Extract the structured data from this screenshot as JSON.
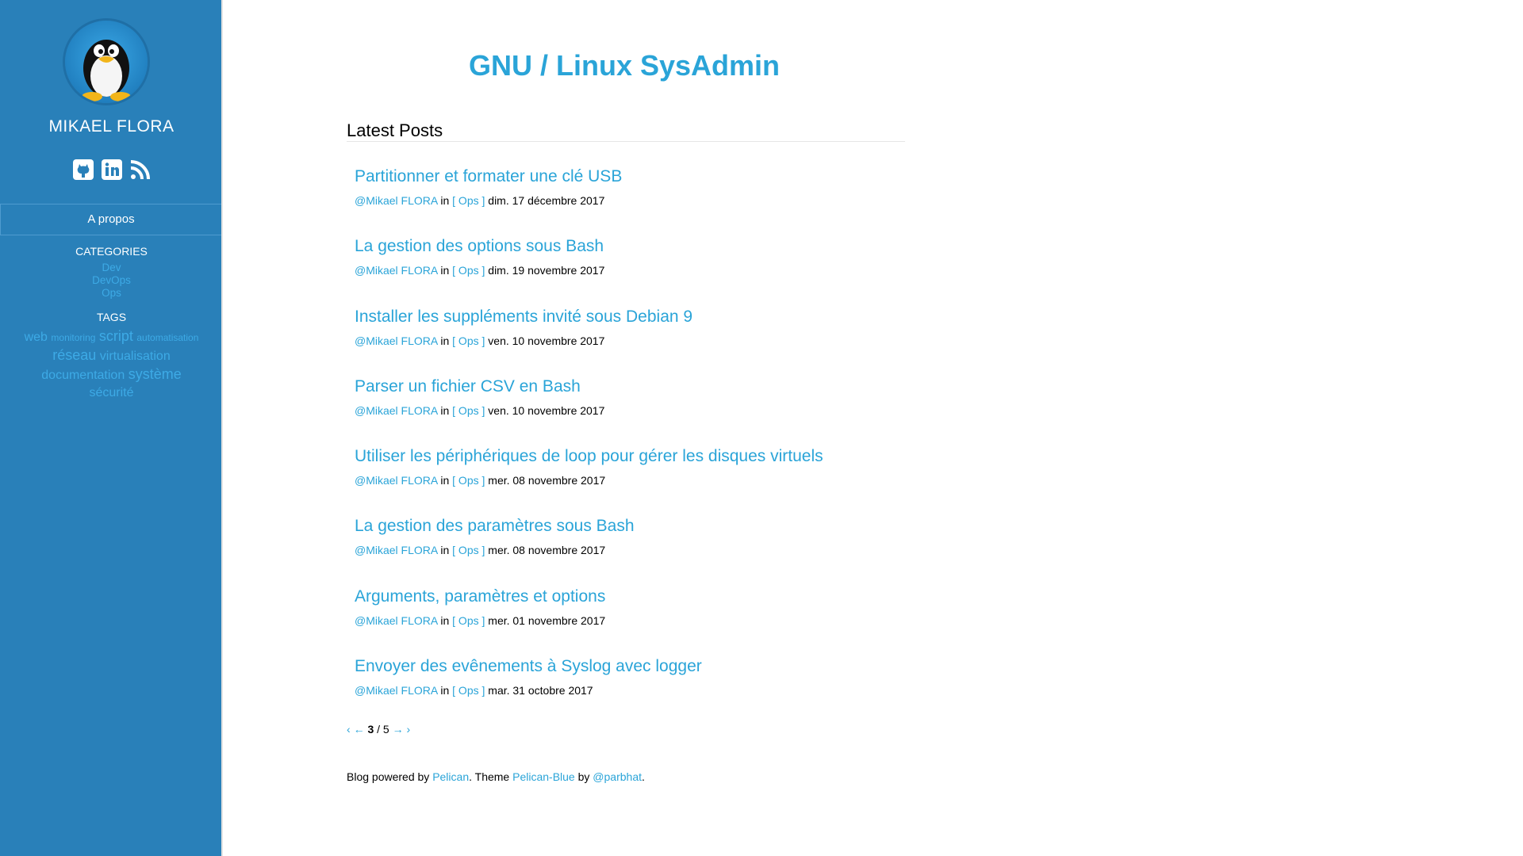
{
  "sidebar": {
    "author_name": "MIKAEL FLORA",
    "avatar_icon": "tux-penguin-avatar",
    "social": [
      {
        "name": "github-icon"
      },
      {
        "name": "linkedin-icon"
      },
      {
        "name": "rss-icon"
      }
    ],
    "about_label": "A propos",
    "categories_title": "CATEGORIES",
    "categories": [
      "Dev",
      "DevOps",
      "Ops"
    ],
    "tags_title": "TAGS",
    "tags": {
      "web": "web",
      "monitoring": "monitoring",
      "script": "script",
      "automatisation": "automatisation",
      "reseau": "réseau",
      "virtualisation": "virtualisation",
      "documentation": "documentation",
      "systeme": "système",
      "securite": "sécurité"
    },
    "colors": {
      "background": "#2980b9",
      "link": "#3daae6"
    }
  },
  "header": {
    "site_title": "GNU / Linux SysAdmin",
    "section_title": "Latest Posts"
  },
  "posts": [
    {
      "title": "Partitionner et formater une clé USB",
      "author": "@Mikael FLORA",
      "in": "in",
      "category": "[ Ops ]",
      "date": "dim. 17 décembre 2017"
    },
    {
      "title": "La gestion des options sous Bash",
      "author": "@Mikael FLORA",
      "in": "in",
      "category": "[ Ops ]",
      "date": "dim. 19 novembre 2017"
    },
    {
      "title": "Installer les suppléments invité sous Debian 9",
      "author": "@Mikael FLORA",
      "in": "in",
      "category": "[ Ops ]",
      "date": "ven. 10 novembre 2017"
    },
    {
      "title": "Parser un fichier CSV en Bash",
      "author": "@Mikael FLORA",
      "in": "in",
      "category": "[ Ops ]",
      "date": "ven. 10 novembre 2017"
    },
    {
      "title": "Utiliser les périphériques de loop pour gérer les disques virtuels",
      "author": "@Mikael FLORA",
      "in": "in",
      "category": "[ Ops ]",
      "date": "mer. 08 novembre 2017"
    },
    {
      "title": "La gestion des paramètres sous Bash",
      "author": "@Mikael FLORA",
      "in": "in",
      "category": "[ Ops ]",
      "date": "mer. 08 novembre 2017"
    },
    {
      "title": "Arguments, paramètres et options",
      "author": "@Mikael FLORA",
      "in": "in",
      "category": "[ Ops ]",
      "date": "mer. 01 novembre 2017"
    },
    {
      "title": "Envoyer des evênements à Syslog avec logger",
      "author": "@Mikael FLORA",
      "in": "in",
      "category": "[ Ops ]",
      "date": "mar. 31 octobre 2017"
    }
  ],
  "pagination": {
    "first": "‹",
    "prev": "←",
    "current": "3",
    "separator": "/",
    "total": "5",
    "next": "→",
    "last": "›"
  },
  "footer": {
    "prefix": "Blog powered by",
    "pelican": "Pelican",
    "mid": ". Theme",
    "theme": "Pelican-Blue",
    "by": "by",
    "author": "@parbhat",
    "end": "."
  },
  "accent_color": "#2aa4d8"
}
